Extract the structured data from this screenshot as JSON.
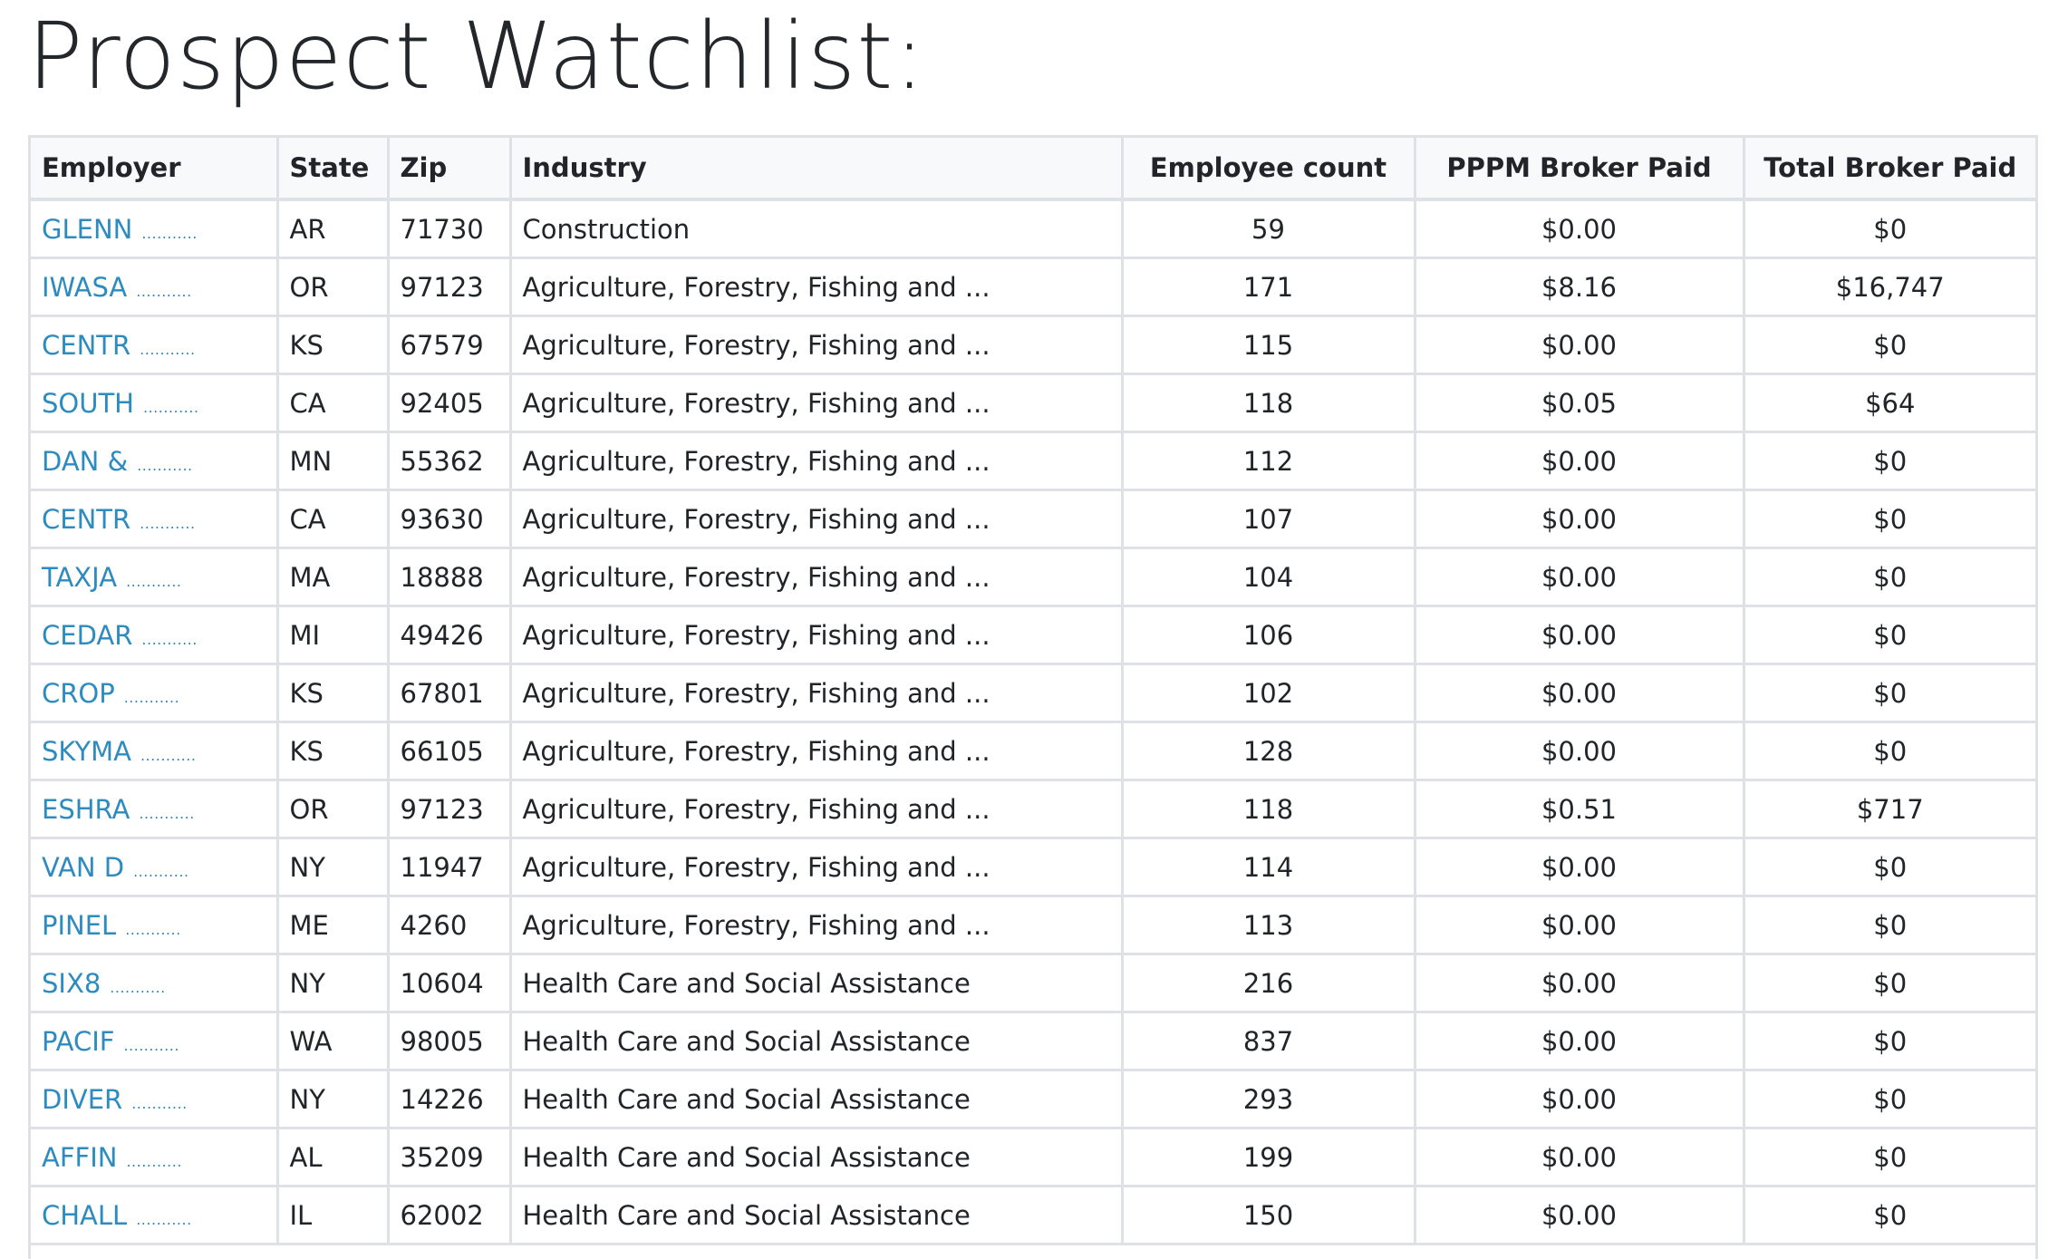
{
  "page": {
    "title": "Prospect Watchlist:"
  },
  "table": {
    "headers": {
      "employer": "Employer",
      "state": "State",
      "zip": "Zip",
      "industry": "Industry",
      "employee_count": "Employee count",
      "pppm": "PPPM Broker Paid",
      "total": "Total Broker Paid"
    },
    "rows": [
      {
        "employer": "GLENN",
        "dots": "...........",
        "state": "AR",
        "zip": "71730",
        "industry": "Construction",
        "employees": "59",
        "pppm": "$0.00",
        "total": "$0"
      },
      {
        "employer": "IWASA",
        "dots": "...........",
        "state": "OR",
        "zip": "97123",
        "industry": "Agriculture, Forestry, Fishing and ...",
        "employees": "171",
        "pppm": "$8.16",
        "total": "$16,747"
      },
      {
        "employer": "CENTR",
        "dots": "...........",
        "state": "KS",
        "zip": "67579",
        "industry": "Agriculture, Forestry, Fishing and ...",
        "employees": "115",
        "pppm": "$0.00",
        "total": "$0"
      },
      {
        "employer": "SOUTH",
        "dots": "...........",
        "state": "CA",
        "zip": "92405",
        "industry": "Agriculture, Forestry, Fishing and ...",
        "employees": "118",
        "pppm": "$0.05",
        "total": "$64"
      },
      {
        "employer": "DAN &",
        "dots": "...........",
        "state": "MN",
        "zip": "55362",
        "industry": "Agriculture, Forestry, Fishing and ...",
        "employees": "112",
        "pppm": "$0.00",
        "total": "$0"
      },
      {
        "employer": "CENTR",
        "dots": "...........",
        "state": "CA",
        "zip": "93630",
        "industry": "Agriculture, Forestry, Fishing and ...",
        "employees": "107",
        "pppm": "$0.00",
        "total": "$0"
      },
      {
        "employer": "TAXJA",
        "dots": "...........",
        "state": "MA",
        "zip": "18888",
        "industry": "Agriculture, Forestry, Fishing and ...",
        "employees": "104",
        "pppm": "$0.00",
        "total": "$0"
      },
      {
        "employer": "CEDAR",
        "dots": "...........",
        "state": "MI",
        "zip": "49426",
        "industry": "Agriculture, Forestry, Fishing and ...",
        "employees": "106",
        "pppm": "$0.00",
        "total": "$0"
      },
      {
        "employer": "CROP",
        "dots": "...........",
        "state": "KS",
        "zip": "67801",
        "industry": "Agriculture, Forestry, Fishing and ...",
        "employees": "102",
        "pppm": "$0.00",
        "total": "$0"
      },
      {
        "employer": "SKYMA",
        "dots": "...........",
        "state": "KS",
        "zip": "66105",
        "industry": "Agriculture, Forestry, Fishing and ...",
        "employees": "128",
        "pppm": "$0.00",
        "total": "$0"
      },
      {
        "employer": "ESHRA",
        "dots": "...........",
        "state": "OR",
        "zip": "97123",
        "industry": "Agriculture, Forestry, Fishing and ...",
        "employees": "118",
        "pppm": "$0.51",
        "total": "$717"
      },
      {
        "employer": "VAN D",
        "dots": "...........",
        "state": "NY",
        "zip": "11947",
        "industry": "Agriculture, Forestry, Fishing and ...",
        "employees": "114",
        "pppm": "$0.00",
        "total": "$0"
      },
      {
        "employer": "PINEL",
        "dots": "...........",
        "state": "ME",
        "zip": "4260",
        "industry": "Agriculture, Forestry, Fishing and ...",
        "employees": "113",
        "pppm": "$0.00",
        "total": "$0"
      },
      {
        "employer": "SIX8",
        "dots": "...........",
        "state": "NY",
        "zip": "10604",
        "industry": "Health Care and Social Assistance",
        "employees": "216",
        "pppm": "$0.00",
        "total": "$0"
      },
      {
        "employer": "PACIF",
        "dots": "...........",
        "state": "WA",
        "zip": "98005",
        "industry": "Health Care and Social Assistance",
        "employees": "837",
        "pppm": "$0.00",
        "total": "$0"
      },
      {
        "employer": "DIVER",
        "dots": "...........",
        "state": "NY",
        "zip": "14226",
        "industry": "Health Care and Social Assistance",
        "employees": "293",
        "pppm": "$0.00",
        "total": "$0"
      },
      {
        "employer": "AFFIN",
        "dots": "...........",
        "state": "AL",
        "zip": "35209",
        "industry": "Health Care and Social Assistance",
        "employees": "199",
        "pppm": "$0.00",
        "total": "$0"
      },
      {
        "employer": "CHALL",
        "dots": "...........",
        "state": "IL",
        "zip": "62002",
        "industry": "Health Care and Social Assistance",
        "employees": "150",
        "pppm": "$0.00",
        "total": "$0"
      }
    ]
  },
  "colors": {
    "link": "#2d8bc0",
    "header_bg": "#f8f9fa",
    "border": "#dee2e6",
    "text": "#212529"
  }
}
